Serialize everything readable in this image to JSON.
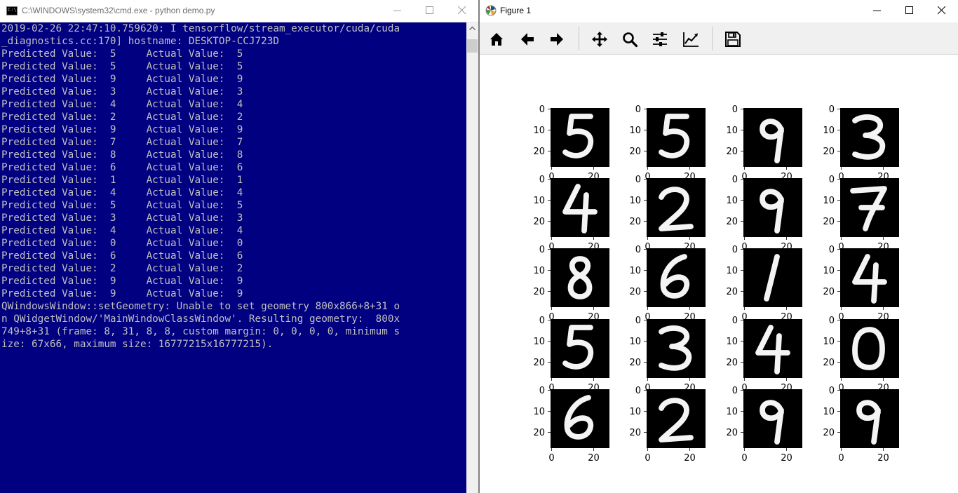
{
  "cmd": {
    "title": "C:\\WINDOWS\\system32\\cmd.exe - python  demo.py",
    "app_icon_text": "C:\\",
    "lines": [
      "2019-02-26 22:47:10.759620: I tensorflow/stream_executor/cuda/cuda",
      "_diagnostics.cc:170] hostname: DESKTOP-CCJ723D",
      "Predicted Value:  5     Actual Value:  5",
      "Predicted Value:  5     Actual Value:  5",
      "Predicted Value:  9     Actual Value:  9",
      "Predicted Value:  3     Actual Value:  3",
      "Predicted Value:  4     Actual Value:  4",
      "Predicted Value:  2     Actual Value:  2",
      "Predicted Value:  9     Actual Value:  9",
      "Predicted Value:  7     Actual Value:  7",
      "Predicted Value:  8     Actual Value:  8",
      "Predicted Value:  6     Actual Value:  6",
      "Predicted Value:  1     Actual Value:  1",
      "Predicted Value:  4     Actual Value:  4",
      "Predicted Value:  5     Actual Value:  5",
      "Predicted Value:  3     Actual Value:  3",
      "Predicted Value:  4     Actual Value:  4",
      "Predicted Value:  0     Actual Value:  0",
      "Predicted Value:  6     Actual Value:  6",
      "Predicted Value:  2     Actual Value:  2",
      "Predicted Value:  9     Actual Value:  9",
      "Predicted Value:  9     Actual Value:  9",
      "QWindowsWindow::setGeometry: Unable to set geometry 800x866+8+31 o",
      "n QWidgetWindow/'MainWindowClassWindow'. Resulting geometry:  800x",
      "749+8+31 (frame: 8, 31, 8, 8, custom margin: 0, 0, 0, 0, minimum s",
      "ize: 67x66, maximum size: 16777215x16777215)."
    ],
    "colors": {
      "background": "#000080",
      "text": "#c0c0c0"
    },
    "controls": [
      "minimize-icon",
      "maximize-icon",
      "close-icon"
    ]
  },
  "figure": {
    "title": "Figure 1",
    "toolbar": [
      "home-icon",
      "back-arrow-icon",
      "forward-arrow-icon",
      "pan-move-icon",
      "zoom-magnifier-icon",
      "subplots-sliders-icon",
      "edit-axes-lines-icon",
      "save-disk-icon"
    ],
    "controls": [
      "minimize-icon",
      "maximize-icon",
      "close-icon"
    ],
    "digits": [
      5,
      5,
      9,
      3,
      4,
      2,
      9,
      7,
      8,
      6,
      1,
      4,
      5,
      3,
      4,
      0,
      6,
      2,
      9,
      9
    ],
    "grid_rows": 5,
    "grid_cols": 4,
    "ytick_labels": [
      "0",
      "10",
      "20"
    ],
    "xtick_labels": [
      "0",
      "20"
    ]
  }
}
